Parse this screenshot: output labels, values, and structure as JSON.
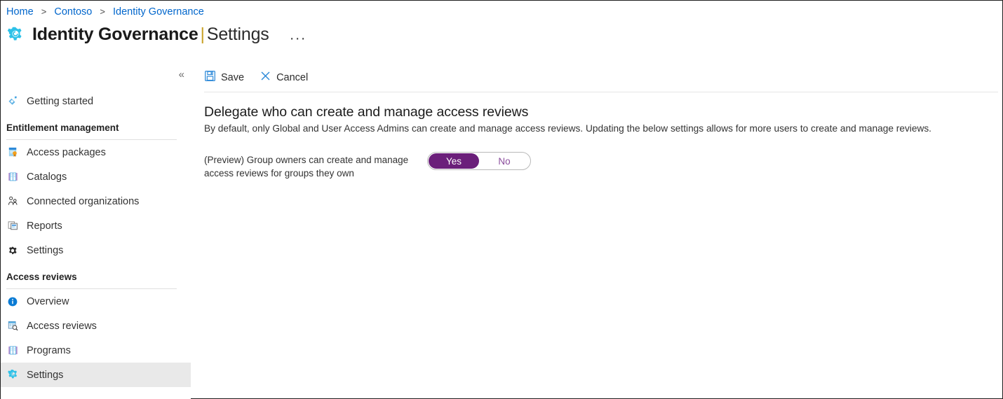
{
  "breadcrumb": {
    "items": [
      "Home",
      "Contoso",
      "Identity Governance"
    ],
    "separator": ">"
  },
  "header": {
    "icon": "identity-governance-gear-icon",
    "title": "Identity Governance",
    "divider": "|",
    "subtitle": "Settings",
    "more_label": "···"
  },
  "sidebar": {
    "collapse_label": "«",
    "top_items": [
      {
        "label": "Getting started",
        "icon": "rocket-icon",
        "selected": false
      }
    ],
    "sections": [
      {
        "title": "Entitlement management",
        "items": [
          {
            "label": "Access packages",
            "icon": "access-package-icon",
            "selected": false
          },
          {
            "label": "Catalogs",
            "icon": "catalog-book-icon",
            "selected": false
          },
          {
            "label": "Connected organizations",
            "icon": "people-icon",
            "selected": false
          },
          {
            "label": "Reports",
            "icon": "reports-icon",
            "selected": false
          },
          {
            "label": "Settings",
            "icon": "gear-icon",
            "selected": false
          }
        ]
      },
      {
        "title": "Access reviews",
        "items": [
          {
            "label": "Overview",
            "icon": "info-circle-icon",
            "selected": false
          },
          {
            "label": "Access reviews",
            "icon": "access-review-search-icon",
            "selected": false
          },
          {
            "label": "Programs",
            "icon": "programs-book-icon",
            "selected": false
          },
          {
            "label": "Settings",
            "icon": "settings-gear-icon",
            "selected": true
          }
        ]
      }
    ]
  },
  "toolbar": {
    "save_label": "Save",
    "cancel_label": "Cancel"
  },
  "main": {
    "section_title": "Delegate who can create and manage access reviews",
    "section_description": "By default, only Global and User Access Admins can create and manage access reviews. Updating the below settings allows for more users to create and manage reviews.",
    "setting": {
      "label": "(Preview) Group owners can create and manage access reviews for groups they own",
      "toggle": {
        "on_label": "Yes",
        "off_label": "No",
        "value": "Yes"
      }
    }
  },
  "colors": {
    "link": "#0066cc",
    "accent_blue": "#0078d4",
    "toggle_purple": "#6b1f7a",
    "toggle_off_text": "#8a4c9c",
    "title_bar": "#c9a227",
    "selected_bg": "#e9e9e9"
  }
}
